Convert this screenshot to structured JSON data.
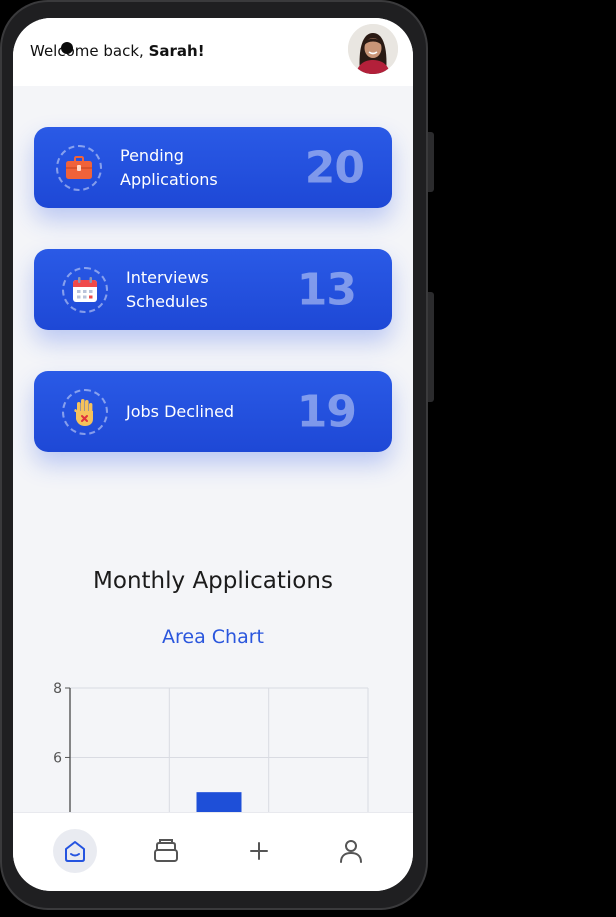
{
  "header": {
    "greeting_prefix": "Welcome back, ",
    "user_name": "Sarah!"
  },
  "stats": [
    {
      "label": "Pending\nApplications",
      "value": "20",
      "icon": "briefcase-icon"
    },
    {
      "label": "Interviews\nSchedules",
      "value": "13",
      "icon": "calendar-icon"
    },
    {
      "label": "Jobs Declined",
      "value": "19",
      "icon": "raised-hand-icon"
    }
  ],
  "chart_section": {
    "title": "Monthly Applications",
    "subtitle": "Area Chart"
  },
  "chart_data": {
    "type": "bar",
    "title": "Monthly Applications",
    "subtitle": "Area Chart",
    "y_ticks": [
      "8",
      "6"
    ],
    "ylim_visible": [
      4.4,
      8
    ],
    "categories": [
      "",
      "",
      ""
    ],
    "values": [
      null,
      5,
      null
    ],
    "bar_color": "#1e4fd8",
    "grid": true
  },
  "bottom_nav": {
    "items": [
      {
        "icon": "home-icon",
        "active": true
      },
      {
        "icon": "archive-icon",
        "active": false
      },
      {
        "icon": "plus-icon",
        "active": false
      },
      {
        "icon": "profile-icon",
        "active": false
      }
    ]
  },
  "colors": {
    "accent": "#2554e0",
    "card_value": "#8fa6f0",
    "background": "#f4f5f8"
  }
}
